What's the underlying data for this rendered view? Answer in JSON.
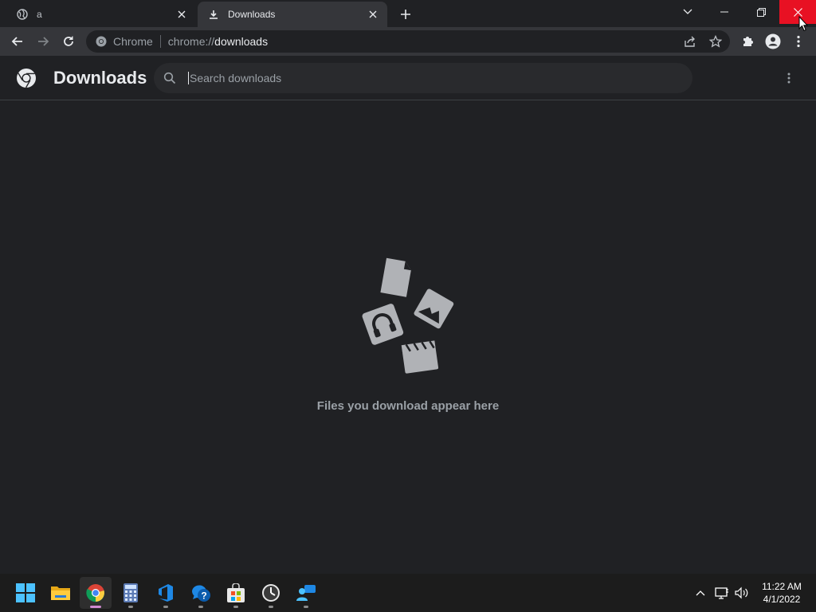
{
  "tabs": [
    {
      "title": "a",
      "icon": "globe-icon",
      "active": false
    },
    {
      "title": "Downloads",
      "icon": "download-icon",
      "active": true
    }
  ],
  "toolbar": {
    "site_label": "Chrome",
    "url_scheme": "chrome://",
    "url_host": "downloads"
  },
  "downloads": {
    "title": "Downloads",
    "search_placeholder": "Search downloads",
    "empty_message": "Files you download appear here"
  },
  "taskbar": {
    "apps": [
      "start",
      "file-explorer",
      "chrome",
      "calculator",
      "azure-devops",
      "get-help",
      "microsoft-store",
      "clock",
      "people"
    ],
    "time": "11:22 AM",
    "date": "4/1/2022"
  },
  "colors": {
    "background": "#202124",
    "toolbar": "#35363a",
    "close_hover": "#e81123",
    "text_primary": "#e8eaed",
    "text_secondary": "#9aa0a6",
    "illustration": "#b0b2b6"
  }
}
